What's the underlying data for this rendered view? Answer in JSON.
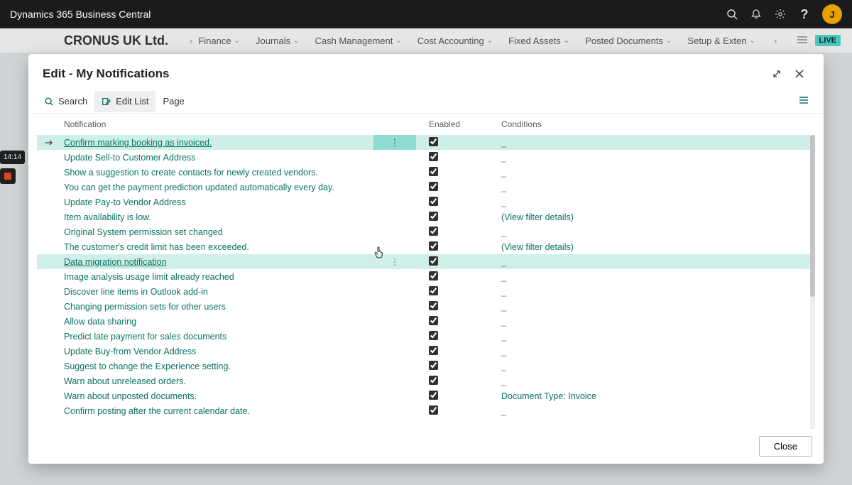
{
  "appbar": {
    "title": "Dynamics 365 Business Central",
    "avatar_initial": "J"
  },
  "floating": {
    "time": "14:14"
  },
  "navstrip": {
    "company": "CRONUS UK Ltd.",
    "items": [
      "Finance",
      "Journals",
      "Cash Management",
      "Cost Accounting",
      "Fixed Assets",
      "Posted Documents",
      "Setup & Exten"
    ],
    "live_label": "LIVE"
  },
  "modal": {
    "title": "Edit - My Notifications",
    "toolbar": {
      "search": "Search",
      "edit_list": "Edit List",
      "page": "Page"
    },
    "columns": {
      "notification": "Notification",
      "enabled": "Enabled",
      "conditions": "Conditions"
    },
    "close_label": "Close"
  },
  "rows": [
    {
      "label": "Confirm marking booking as invoiced.",
      "enabled": true,
      "condition": "_",
      "selected": true,
      "underline": true
    },
    {
      "label": "Update Sell-to Customer Address",
      "enabled": true,
      "condition": "_"
    },
    {
      "label": "Show a suggestion to create contacts for newly created vendors.",
      "enabled": true,
      "condition": "_"
    },
    {
      "label": "You can get the payment prediction updated automatically every day.",
      "enabled": true,
      "condition": "_"
    },
    {
      "label": "Update Pay-to Vendor Address",
      "enabled": true,
      "condition": "_"
    },
    {
      "label": "Item availability is low.",
      "enabled": true,
      "condition": "(View filter details)"
    },
    {
      "label": "Original System permission set changed",
      "enabled": true,
      "condition": "_"
    },
    {
      "label": "The customer's credit limit has been exceeded.",
      "enabled": true,
      "condition": "(View filter details)"
    },
    {
      "label": "Data migration notification",
      "enabled": true,
      "condition": "_",
      "hover": true,
      "underline": true
    },
    {
      "label": "Image analysis usage limit already reached",
      "enabled": true,
      "condition": "_"
    },
    {
      "label": "Discover line items in Outlook add-in",
      "enabled": true,
      "condition": "_"
    },
    {
      "label": "Changing permission sets for other users",
      "enabled": true,
      "condition": "_"
    },
    {
      "label": "Allow data sharing",
      "enabled": true,
      "condition": "_"
    },
    {
      "label": "Predict late payment for sales documents",
      "enabled": true,
      "condition": "_"
    },
    {
      "label": "Update Buy-from Vendor Address",
      "enabled": true,
      "condition": "_"
    },
    {
      "label": "Suggest to change the Experience setting.",
      "enabled": true,
      "condition": "_"
    },
    {
      "label": "Warn about unreleased orders.",
      "enabled": true,
      "condition": "_"
    },
    {
      "label": "Warn about unposted documents.",
      "enabled": true,
      "condition": "Document Type: Invoice"
    },
    {
      "label": "Confirm posting after the current calendar date.",
      "enabled": true,
      "condition": "_"
    }
  ]
}
